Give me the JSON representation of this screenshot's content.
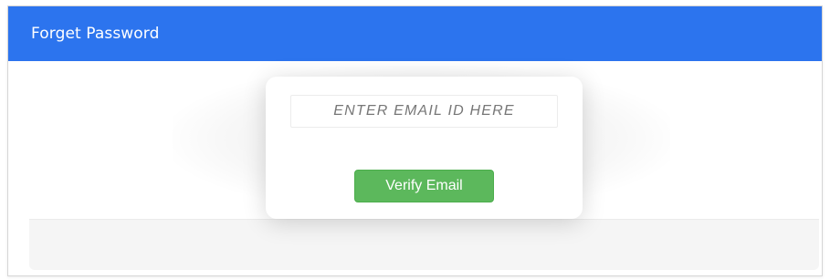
{
  "panel": {
    "title": "Forget Password"
  },
  "form": {
    "email_placeholder": "ENTER EMAIL ID HERE",
    "email_value": "",
    "verify_label": "Verify Email"
  },
  "colors": {
    "header": "#2c74ee",
    "verify_button": "#5cb85c",
    "footer": "#f5f5f5"
  }
}
